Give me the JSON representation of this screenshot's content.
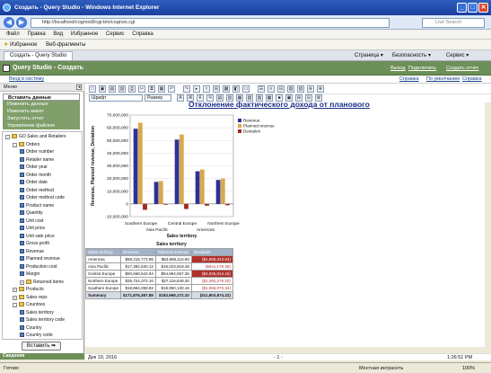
{
  "window": {
    "title": "Создать - Query Studio - Windows Internet Explorer",
    "min": "_",
    "max": "□",
    "close": "✕"
  },
  "address": {
    "url": "http://localhost/cognos8/cgi-bin/cognos.cgi",
    "search_placeholder": "Live Search",
    "back": "◀",
    "forward": "▶"
  },
  "menu": [
    "Файл",
    "Правка",
    "Вид",
    "Избранное",
    "Сервис",
    "Справка"
  ],
  "favorites": {
    "label": "Избранное",
    "item": "Веб-фрагменты"
  },
  "tab": {
    "label": "Создать - Query Studio",
    "tools": [
      "Страница ▾",
      "Безопасность ▾",
      "Сервис ▾"
    ]
  },
  "qs": {
    "title": "Query Studio - Создать",
    "links": [
      "Выход",
      "Подключить",
      "Создать отчёт"
    ]
  },
  "qssub": {
    "left": "Вход в систему",
    "right": [
      "Справка",
      "По умолчанию",
      "Справка"
    ]
  },
  "left": {
    "menu_label": "Меню",
    "items": [
      {
        "label": "Вставить данные",
        "active": true
      },
      {
        "label": "Изменить данные",
        "active": false
      },
      {
        "label": "Изменить макет",
        "active": false
      },
      {
        "label": "Запустить отчет",
        "active": false
      },
      {
        "label": "Управление файлом",
        "active": false
      }
    ],
    "tree": [
      {
        "label": "GO Sales and Retailers",
        "kind": "folder",
        "level": 0,
        "exp": "-"
      },
      {
        "label": "Orders",
        "kind": "folder",
        "level": 1,
        "exp": "-"
      },
      {
        "label": "Order number",
        "kind": "item",
        "level": 2
      },
      {
        "label": "Retailer name",
        "kind": "item",
        "level": 2
      },
      {
        "label": "Order year",
        "kind": "item",
        "level": 2
      },
      {
        "label": "Order month",
        "kind": "item",
        "level": 2
      },
      {
        "label": "Order date",
        "kind": "item",
        "level": 2
      },
      {
        "label": "Order method",
        "kind": "item",
        "level": 2
      },
      {
        "label": "Order method code",
        "kind": "item",
        "level": 2
      },
      {
        "label": "Product name",
        "kind": "item",
        "level": 2
      },
      {
        "label": "Quantity",
        "kind": "item",
        "level": 2
      },
      {
        "label": "Unit cost",
        "kind": "item",
        "level": 2
      },
      {
        "label": "Unit price",
        "kind": "item",
        "level": 2
      },
      {
        "label": "Unit sale price",
        "kind": "item",
        "level": 2
      },
      {
        "label": "Gross profit",
        "kind": "item",
        "level": 2
      },
      {
        "label": "Revenue",
        "kind": "item",
        "level": 2
      },
      {
        "label": "Planned revenue",
        "kind": "item",
        "level": 2
      },
      {
        "label": "Production cost",
        "kind": "item",
        "level": 2
      },
      {
        "label": "Margin",
        "kind": "item",
        "level": 2
      },
      {
        "label": "Returned items",
        "kind": "folder",
        "level": 2,
        "exp": "+"
      },
      {
        "label": "Products",
        "kind": "folder",
        "level": 1,
        "exp": "+"
      },
      {
        "label": "Sales reps",
        "kind": "folder",
        "level": 1,
        "exp": "+"
      },
      {
        "label": "Countries",
        "kind": "folder",
        "level": 1,
        "exp": "-"
      },
      {
        "label": "Sales territory",
        "kind": "item",
        "level": 2
      },
      {
        "label": "Sales territory code",
        "kind": "item",
        "level": 2
      },
      {
        "label": "Country",
        "kind": "item",
        "level": 2
      },
      {
        "label": "Country code",
        "kind": "item",
        "level": 2
      }
    ],
    "insert": "Вставить ➡",
    "info": "Сведения"
  },
  "toolbar": {
    "font": "Шрифт",
    "size": "Размер"
  },
  "report": {
    "title": "Отклонение фактического дохода от планового"
  },
  "chart_data": {
    "type": "bar",
    "categories": [
      "Americas",
      "Asia Pacific",
      "Central Europe",
      "Northern Europe",
      "Southern Europe"
    ],
    "x_tick_labels": [
      "Southern Europe",
      "Asia Pacific",
      "Central Europe",
      "Americas",
      "Northern Europe"
    ],
    "series": [
      {
        "name": "Revenue",
        "values": [
          59216772,
          17382640,
          50668542,
          25724372,
          18884059
        ],
        "color": "#2e3192"
      },
      {
        "name": "Planned revenue",
        "values": [
          63885116,
          18023819,
          54694557,
          27116649,
          19950130
        ],
        "color": "#d9a84e"
      },
      {
        "name": "Deviation",
        "values": [
          -4668344,
          -641179,
          -4026015,
          -1392276,
          -1066071
        ],
        "color": "#9c2b23"
      }
    ],
    "ylabel": "Revenue, Planned revenue, Deviation",
    "xlabel": "Sales territory",
    "yticks": [
      "70,000,000",
      "60,000,000",
      "50,000,000",
      "40,000,000",
      "30,000,000",
      "20,000,000",
      "10,000,000",
      "0",
      "-10,000,000"
    ],
    "ylim": [
      -10000000,
      70000000
    ],
    "legend": "top-right"
  },
  "table": {
    "headers": [
      "Sales territory",
      "Revenue",
      "Planned revenue",
      "Deviation"
    ],
    "rows": [
      [
        "Americas",
        "$59,216,772.96",
        "$63,885,116.80",
        "($4,668,343.84)"
      ],
      [
        "Asia Pacific",
        "$17,382,640.12",
        "$18,023,819.48",
        "($641,179.36)"
      ],
      [
        "Central Europe",
        "$50,668,542.94",
        "$54,694,557.36",
        "($4,026,014.42)"
      ],
      [
        "Northern Europe",
        "$25,724,372.10",
        "$27,116,648.30",
        "($1,392,276.20)"
      ],
      [
        "Southern Europe",
        "$18,884,059.82",
        "$19,950,130.16",
        "($1,066,070.34)"
      ]
    ],
    "summary": [
      "Summary",
      "$171,876,387.88",
      "$183,668,172.10",
      "($11,803,874.22)"
    ]
  },
  "footer": {
    "date": "Дек 19, 2016",
    "page": "- 1 -",
    "time": "1:26:51 PM"
  },
  "status": {
    "left": "Готово",
    "zone": "Местная интрасеть",
    "zoom": "100%"
  }
}
